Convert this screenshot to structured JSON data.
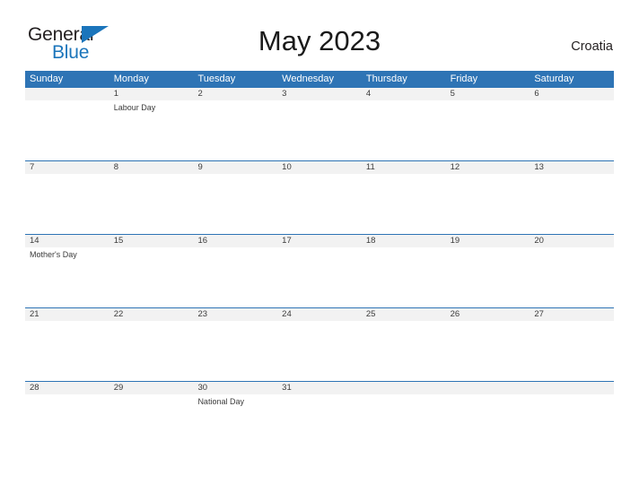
{
  "brand": {
    "word1": "General",
    "word2": "Blue",
    "flag_icon": "blue-triangle-flag-icon",
    "color_word1": "#231f20",
    "color_word2": "#1b75bb",
    "color_flag": "#1b75bb"
  },
  "header": {
    "title": "May 2023",
    "country": "Croatia"
  },
  "theme": {
    "header_blue": "#2e74b5",
    "date_band_gray": "#f2f2f2",
    "text_dark": "#3b3b3b",
    "page_background": "#ffffff"
  },
  "calendar": {
    "weekdays": [
      "Sunday",
      "Monday",
      "Tuesday",
      "Wednesday",
      "Thursday",
      "Friday",
      "Saturday"
    ],
    "weeks": [
      {
        "dates": [
          "",
          "1",
          "2",
          "3",
          "4",
          "5",
          "6"
        ],
        "events": [
          "",
          "Labour Day",
          "",
          "",
          "",
          "",
          ""
        ]
      },
      {
        "dates": [
          "7",
          "8",
          "9",
          "10",
          "11",
          "12",
          "13"
        ],
        "events": [
          "",
          "",
          "",
          "",
          "",
          "",
          ""
        ]
      },
      {
        "dates": [
          "14",
          "15",
          "16",
          "17",
          "18",
          "19",
          "20"
        ],
        "events": [
          "Mother's Day",
          "",
          "",
          "",
          "",
          "",
          ""
        ]
      },
      {
        "dates": [
          "21",
          "22",
          "23",
          "24",
          "25",
          "26",
          "27"
        ],
        "events": [
          "",
          "",
          "",
          "",
          "",
          "",
          ""
        ]
      },
      {
        "dates": [
          "28",
          "29",
          "30",
          "31",
          "",
          "",
          ""
        ],
        "events": [
          "",
          "",
          "National Day",
          "",
          "",
          "",
          ""
        ]
      }
    ]
  }
}
